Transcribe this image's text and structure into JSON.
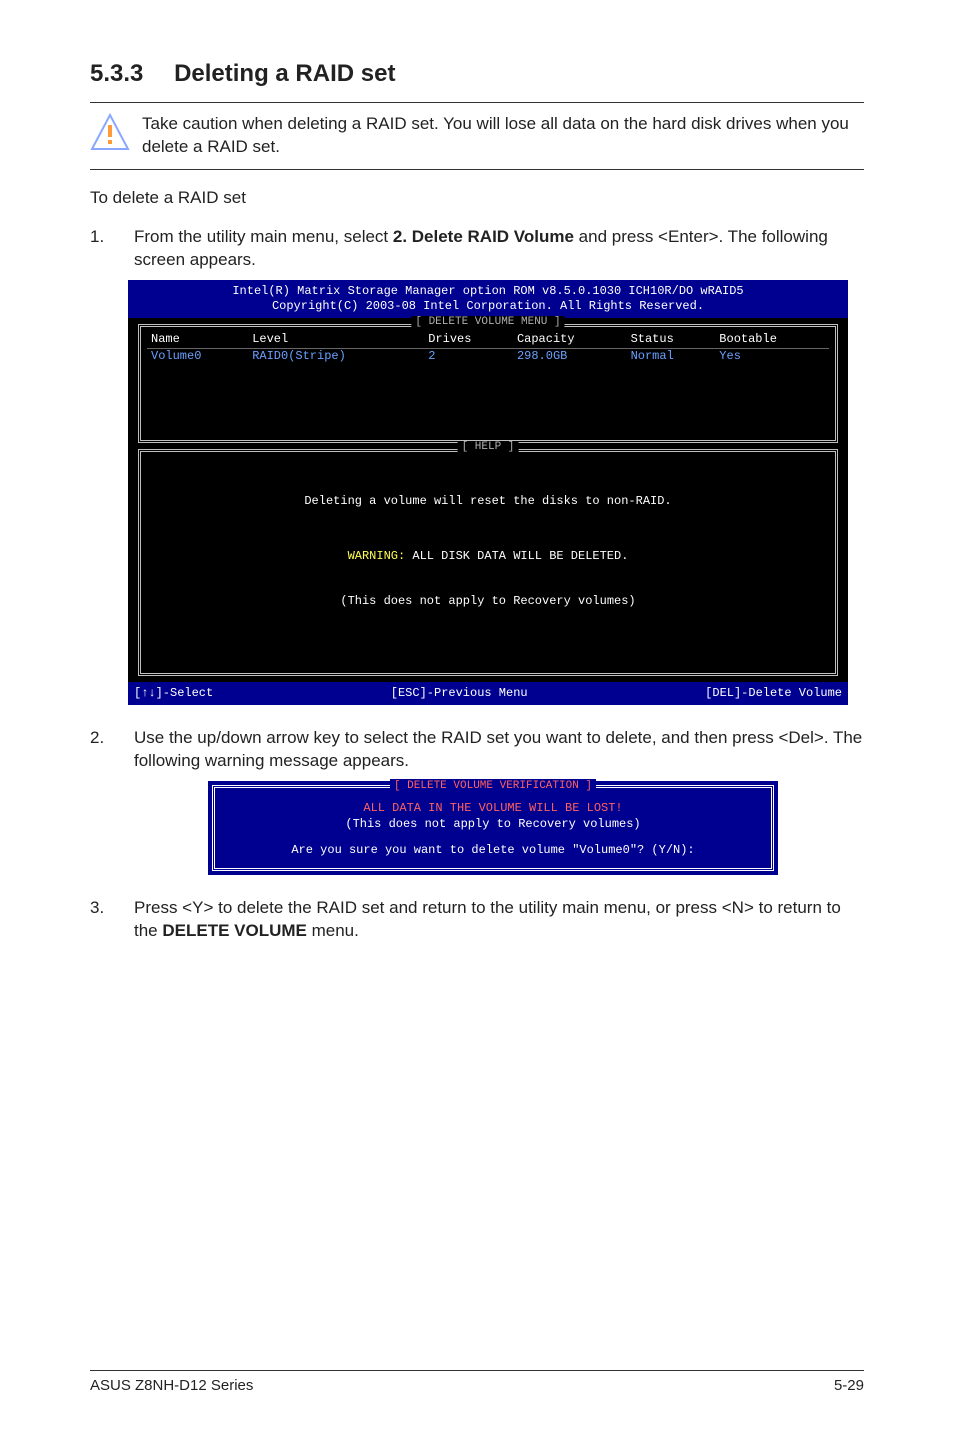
{
  "heading": {
    "num": "5.3.3",
    "title": "Deleting a RAID set"
  },
  "caution": "Take caution when deleting a RAID set. You will lose all data on the hard disk drives when you delete a RAID set.",
  "subhead": "To delete a RAID set",
  "steps": {
    "s1_a": "From the utility main menu, select ",
    "s1_b": "2. Delete RAID Volume",
    "s1_c": " and press <Enter>. The following screen appears.",
    "s2": "Use the up/down arrow key to select the RAID set you want to delete, and then press <Del>. The following warning message appears.",
    "s3_a": "Press <Y> to delete the RAID set and return to the utility main menu, or press <N> to return to the ",
    "s3_b": "DELETE VOLUME",
    "s3_c": " menu."
  },
  "bios": {
    "banner1": "Intel(R) Matrix Storage Manager option ROM v8.5.0.1030 ICH10R/DO wRAID5",
    "banner2": "Copyright(C) 2003-08 Intel Corporation.  All Rights Reserved.",
    "delete_menu_title": "[ DELETE VOLUME MENU ]",
    "cols": {
      "name": "Name",
      "level": "Level",
      "drives": "Drives",
      "capacity": "Capacity",
      "status": "Status",
      "bootable": "Bootable"
    },
    "row": {
      "name": "Volume0",
      "level": "RAID0(Stripe)",
      "drives": "2",
      "capacity": "298.0GB",
      "status": "Normal",
      "bootable": "Yes"
    },
    "help_title": "[ HELP ]",
    "help_l1": "Deleting a volume will reset the disks to non-RAID.",
    "help_warn_prefix": "WARNING:",
    "help_warn_rest": " ALL DISK DATA WILL BE DELETED.",
    "help_l3": "(This does not apply to Recovery volumes)",
    "foot_select": "[↑↓]-Select",
    "foot_esc": "[ESC]-Previous Menu",
    "foot_del": "[DEL]-Delete Volume"
  },
  "verify": {
    "title": "[ DELETE VOLUME VERIFICATION ]",
    "l1": "ALL DATA IN THE VOLUME WILL BE LOST!",
    "l2": "(This does not apply to Recovery volumes)",
    "l3": "Are you sure you want to delete volume \"Volume0\"? (Y/N):"
  },
  "footer": {
    "left": "ASUS Z8NH-D12 Series",
    "right": "5-29"
  }
}
